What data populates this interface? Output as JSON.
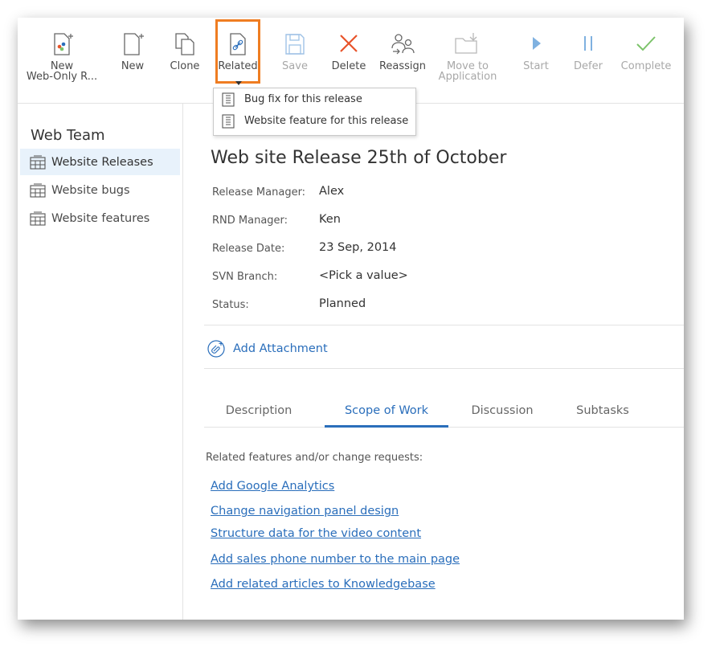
{
  "toolbar": {
    "buttons": [
      {
        "label": "New\nWeb-Only R...",
        "icon": "new-webonly-icon"
      },
      {
        "label": "New",
        "icon": "new-document-icon"
      },
      {
        "label": "Clone",
        "icon": "clone-icon"
      },
      {
        "label": "Related",
        "icon": "related-link-icon"
      },
      {
        "label": "Save",
        "icon": "save-icon",
        "disabled": true
      },
      {
        "label": "Delete",
        "icon": "delete-x-icon"
      },
      {
        "label": "Reassign",
        "icon": "reassign-users-icon"
      },
      {
        "label": "Move to\nApplication",
        "icon": "move-folder-icon",
        "disabled": true
      },
      {
        "label": "Start",
        "icon": "play-icon",
        "disabled": true
      },
      {
        "label": "Defer",
        "icon": "pause-icon",
        "disabled": true
      },
      {
        "label": "Complete",
        "icon": "checkmark-icon",
        "disabled": true
      }
    ],
    "related_menu": [
      "Bug fix for this release",
      "Website feature for this release"
    ]
  },
  "sidebar": {
    "title": "Web Team",
    "items": [
      {
        "label": "Website Releases",
        "active": true
      },
      {
        "label": "Website bugs"
      },
      {
        "label": "Website features"
      }
    ]
  },
  "record": {
    "title": "Web site Release 25th of October",
    "fields": [
      {
        "label": "Release Manager:",
        "value": "Alex"
      },
      {
        "label": "RND Manager:",
        "value": "Ken"
      },
      {
        "label": "Release Date:",
        "value": "23 Sep, 2014"
      },
      {
        "label": "SVN Branch:",
        "value": "<Pick a value>"
      },
      {
        "label": "Status:",
        "value": "Planned"
      }
    ],
    "attachment_label": "Add Attachment"
  },
  "tabs": [
    {
      "label": "Description"
    },
    {
      "label": "Scope of Work",
      "active": true
    },
    {
      "label": "Discussion"
    },
    {
      "label": "Subtasks"
    }
  ],
  "scope": {
    "intro": "Related features and/or change requests:",
    "links": [
      "Add Google Analytics",
      "Change navigation panel design",
      "Structure data for the video content",
      "Add sales phone number to the main page",
      "Add related articles to Knowledgebase"
    ]
  },
  "colors": {
    "accent": "#2a6ebb",
    "highlight": "#ef7d22",
    "delete": "#e8532a",
    "complete": "#7cc36a"
  }
}
